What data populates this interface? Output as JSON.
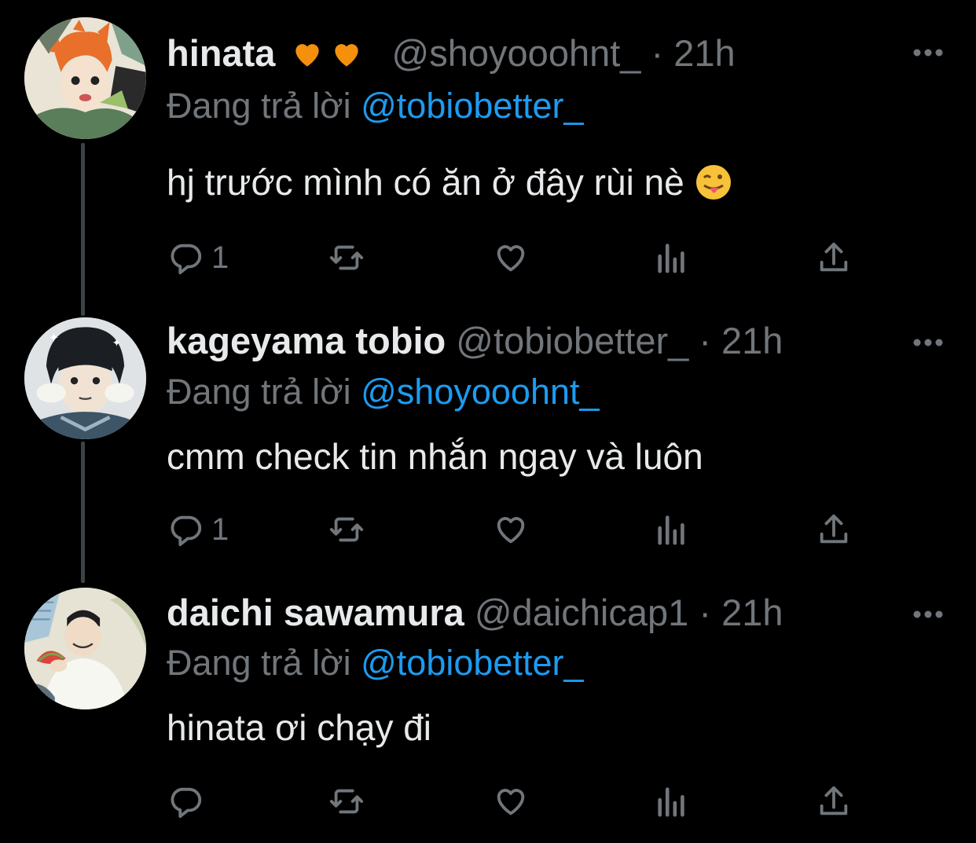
{
  "colors": {
    "background": "#000000",
    "text": "#e7e9ea",
    "secondary": "#71767b",
    "mention": "#1d9bf0",
    "heart": "#f4900c",
    "thread_line": "#3d4246"
  },
  "tweets": [
    {
      "name": "hinata",
      "name_icons": [
        "orange-heart-icon",
        "orange-heart-icon"
      ],
      "handle": "@shoyooohnt_",
      "separator": "·",
      "time": "21h",
      "replying_prefix": "Đang trả lời",
      "replying_to": "@tobiobetter_",
      "text": "hj trước mình có ăn ở đây rùi nè",
      "text_emoji": "tongue-out-emoji",
      "reply_count": "1",
      "actions": [
        "reply-icon",
        "retweet-icon",
        "like-icon",
        "analytics-icon",
        "share-icon"
      ]
    },
    {
      "name": "kageyama tobio",
      "handle": "@tobiobetter_",
      "separator": "·",
      "time": "21h",
      "replying_prefix": "Đang trả lời",
      "replying_to": "@shoyooohnt_",
      "text": "cmm check tin nhắn ngay và luôn",
      "reply_count": "1",
      "actions": [
        "reply-icon",
        "retweet-icon",
        "like-icon",
        "analytics-icon",
        "share-icon"
      ]
    },
    {
      "name": "daichi sawamura",
      "handle": "@daichicap1",
      "separator": "·",
      "time": "21h",
      "replying_prefix": "Đang trả lời",
      "replying_to": "@tobiobetter_",
      "text": "hinata ơi chạy đi",
      "reply_count": "",
      "actions": [
        "reply-icon",
        "retweet-icon",
        "like-icon",
        "analytics-icon",
        "share-icon"
      ]
    }
  ]
}
